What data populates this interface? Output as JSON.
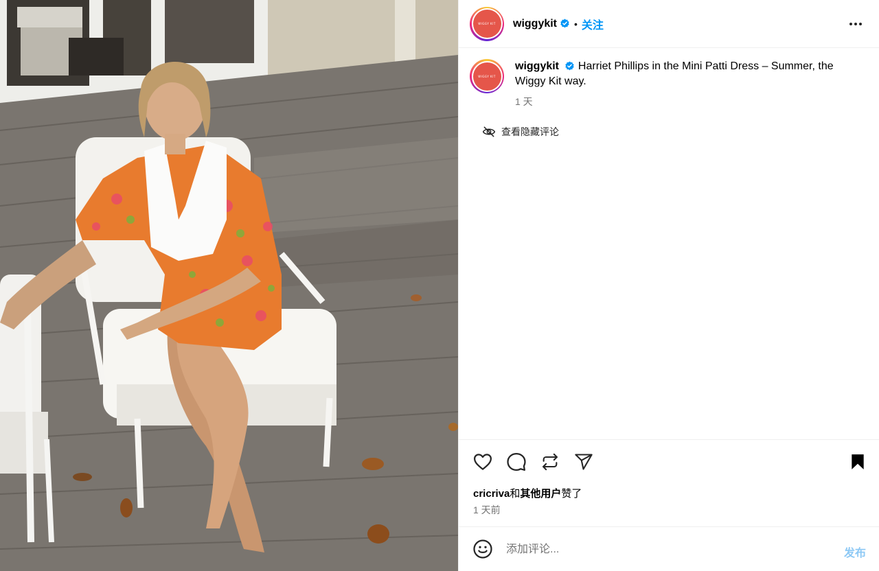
{
  "post": {
    "username": "wiggykit",
    "avatar_text": "WIGGY KIT",
    "follow_label": "关注",
    "caption": "Harriet Phillips in the Mini Patti Dress – Summer, the Wiggy Kit way.",
    "caption_time": "1 天",
    "hidden_comments_label": "查看隐藏评论",
    "likes_user": "cricriva",
    "likes_connector": "和",
    "likes_others": "其他用户",
    "likes_suffix": "赞了",
    "post_time": "1 天前",
    "comment_placeholder": "添加评论...",
    "post_button_label": "发布"
  },
  "icons": {
    "more": "more-horizontal-icon",
    "verified": "verified-badge-icon",
    "hidden": "eye-slash-icon",
    "like": "heart-icon",
    "comment": "comment-bubble-icon",
    "repost": "repost-icon",
    "share": "paper-plane-icon",
    "save": "bookmark-filled-icon",
    "emoji": "emoji-smile-icon"
  },
  "colors": {
    "accent": "#0095f6",
    "post_disabled": "#8ec9f5",
    "avatar_bg": "#e5564a",
    "muted_text": "#737373"
  }
}
